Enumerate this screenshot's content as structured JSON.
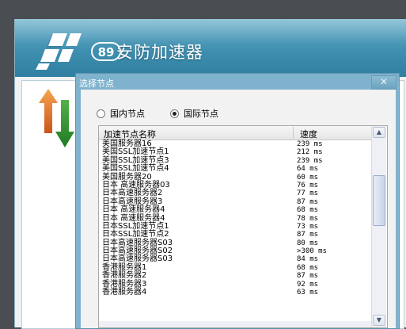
{
  "app": {
    "brand_number": "89",
    "brand_name": "安防加速器"
  },
  "dialog": {
    "title": "选择节点",
    "close_glyph": "✕",
    "radio_domestic": "国内节点",
    "radio_international": "国际节点",
    "selected": "international",
    "table": {
      "columns": [
        "加速节点名称",
        "速度"
      ],
      "rows": [
        {
          "name": "美国服务器16",
          "speed": "239 ms"
        },
        {
          "name": "美国SSL加速节点1",
          "speed": "212 ms"
        },
        {
          "name": "美国SSL加速节点3",
          "speed": "239 ms"
        },
        {
          "name": "美国SSL加速节点4",
          "speed": "64 ms"
        },
        {
          "name": "美国服务器20",
          "speed": "60 ms"
        },
        {
          "name": "日本 高速服务器03",
          "speed": "76 ms"
        },
        {
          "name": "日本高速服务器2",
          "speed": "77 ms"
        },
        {
          "name": "日本高速服务器3",
          "speed": "87 ms"
        },
        {
          "name": "日本 高速服务器4",
          "speed": "68 ms"
        },
        {
          "name": "日本 高速服务器4",
          "speed": "78 ms"
        },
        {
          "name": "日本SSL加速节点1",
          "speed": "73 ms"
        },
        {
          "name": "日本SSL加速节点2",
          "speed": "87 ms"
        },
        {
          "name": "日本高速服务器S03",
          "speed": "80 ms"
        },
        {
          "name": "日本高速服务器S02",
          "speed": ">300 ms"
        },
        {
          "name": "日本高速服务器S03",
          "speed": "84 ms"
        },
        {
          "name": "香港服务器1",
          "speed": "68 ms"
        },
        {
          "name": "香港服务器2",
          "speed": "87 ms"
        },
        {
          "name": "香港服务器3",
          "speed": "92 ms"
        },
        {
          "name": "香港服务器4",
          "speed": "63 ms"
        }
      ]
    }
  },
  "icons": {
    "logo": "accelerator-logo-icon",
    "arrows": "upload-download-arrows-icon",
    "scroll_up": "scroll-up-arrow-icon",
    "scroll_down": "scroll-down-arrow-icon"
  },
  "colors": {
    "banner": "#3f8fb0",
    "dialog_frame": "#7fb2cc",
    "upload_arrow": "#e07a2a",
    "download_arrow": "#2f8f2f"
  }
}
